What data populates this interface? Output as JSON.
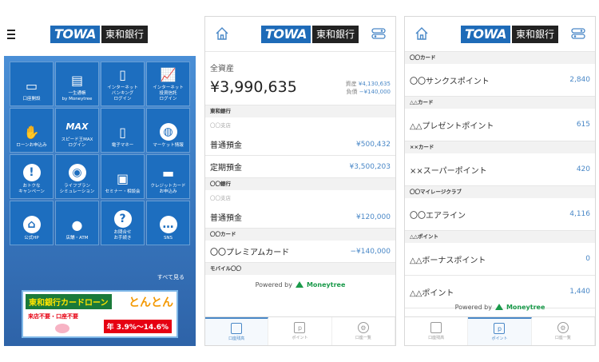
{
  "brand": {
    "logo_en": "TOWA",
    "logo_jp": "東和銀行",
    "blue": "#1d6ebf",
    "accent": "#4a88c7"
  },
  "menu": {
    "tiles": [
      {
        "icon": "card-icon",
        "label": "口座開設"
      },
      {
        "icon": "bank-icon",
        "label": "一生通帳\nby Moneytree"
      },
      {
        "icon": "phone-icon",
        "label": "インターネット\nバンキング\nログイン"
      },
      {
        "icon": "chart-icon",
        "label": "インターネット\n投資信託\nログイン"
      },
      {
        "icon": "hand-phone-icon",
        "label": "ローンお申込み"
      },
      {
        "icon": "max-icon",
        "label": "スピード王MAX\nログイン"
      },
      {
        "icon": "e-money-icon",
        "label": "電子マネー"
      },
      {
        "icon": "globe-icon",
        "label": "マーケット情報"
      },
      {
        "icon": "exclaim-icon",
        "label": "おトクな\nキャンペーン"
      },
      {
        "icon": "life-plan-icon",
        "label": "ライフプラン\nシミュレーション"
      },
      {
        "icon": "seminar-icon",
        "label": "セミナー・相談会"
      },
      {
        "icon": "credit-card-icon",
        "label": "クレジットカード\nお申込み"
      },
      {
        "icon": "home-icon",
        "label": "公式HP"
      },
      {
        "icon": "pin-icon",
        "label": "店舗・ATM"
      },
      {
        "icon": "question-icon",
        "label": "お問合せ\nお手続き"
      },
      {
        "icon": "sns-icon",
        "label": "SNS"
      }
    ],
    "see_all": "すべて見る",
    "banner": {
      "title": "東和銀行カードローン",
      "brand": "とんとん",
      "sub": "来店不要・口座不要",
      "rate": "年 3.9%〜14.6%"
    }
  },
  "assets": {
    "label": "全資産",
    "total": "¥3,990,635",
    "assets_label": "資産",
    "assets_value": "¥4,130,635",
    "liabilities_label": "負債",
    "liabilities_value": "−¥140,000",
    "sections": [
      {
        "name": "東和銀行",
        "branch": "〇〇支店",
        "accounts": [
          {
            "name": "普通預金",
            "value": "¥500,432"
          },
          {
            "name": "定期預金",
            "value": "¥3,500,203"
          }
        ]
      },
      {
        "name": "〇〇銀行",
        "branch": "〇〇支店",
        "accounts": [
          {
            "name": "普通預金",
            "value": "¥120,000"
          }
        ]
      },
      {
        "name": "〇〇カード",
        "branch": "",
        "accounts": [
          {
            "name": "〇〇プレミアムカード",
            "value": "−¥140,000"
          }
        ]
      },
      {
        "name": "モバイル〇〇",
        "branch": "",
        "accounts": []
      }
    ]
  },
  "points": {
    "rows": [
      {
        "section": "〇〇カード",
        "name": "〇〇サンクスポイント",
        "value": "2,840"
      },
      {
        "section": "△△カード",
        "name": "△△プレゼントポイント",
        "value": "615"
      },
      {
        "section": "××カード",
        "name": "××スーパーポイント",
        "value": "420"
      },
      {
        "section": "〇〇マイレージクラブ",
        "name": "〇〇エアライン",
        "value": "4,116"
      },
      {
        "section": "△△ポイント",
        "name": "△△ボーナスポイント",
        "value": "0"
      },
      {
        "section": "",
        "name": "△△ポイント",
        "value": "1,440"
      }
    ]
  },
  "footer": {
    "powered_by": "Powered by",
    "moneytree": "Moneytree",
    "tabs": [
      "口座残高",
      "ポイント",
      "口座一覧"
    ]
  }
}
